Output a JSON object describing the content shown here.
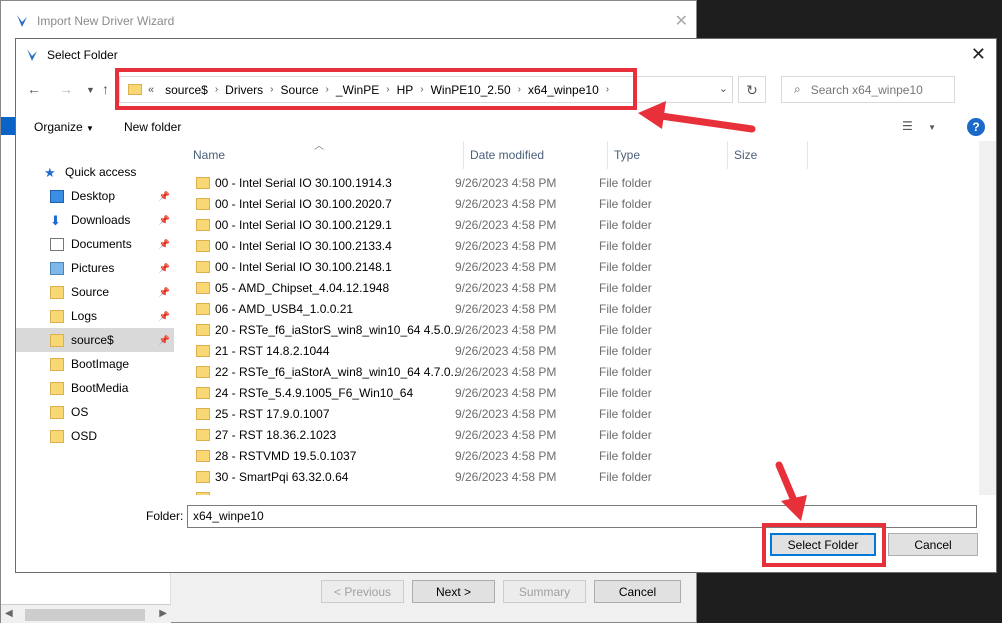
{
  "wizard": {
    "title": "Import New Driver Wizard",
    "buttons": {
      "previous": "< Previous",
      "next": "Next >",
      "summary": "Summary",
      "cancel": "Cancel"
    }
  },
  "dialog": {
    "title": "Select Folder",
    "breadcrumb": [
      "«",
      "source$",
      "Drivers",
      "Source",
      "_WinPE",
      "HP",
      "WinPE10_2.50",
      "x64_winpe10"
    ],
    "search_placeholder": "Search x64_winpe10",
    "toolbar": {
      "organize": "Organize",
      "new_folder": "New folder"
    },
    "columns": {
      "name": "Name",
      "date": "Date modified",
      "type": "Type",
      "size": "Size"
    },
    "sidebar": [
      {
        "label": "Quick access",
        "icon": "star-icon",
        "pinned": false
      },
      {
        "label": "Desktop",
        "icon": "desktop-icon",
        "pinned": true
      },
      {
        "label": "Downloads",
        "icon": "download-arrow-icon",
        "pinned": true
      },
      {
        "label": "Documents",
        "icon": "documents-icon",
        "pinned": true
      },
      {
        "label": "Pictures",
        "icon": "pictures-icon",
        "pinned": true
      },
      {
        "label": "Source",
        "icon": "folder-icon",
        "pinned": true
      },
      {
        "label": "Logs",
        "icon": "folder-icon",
        "pinned": true
      },
      {
        "label": "source$",
        "icon": "network-folder-icon",
        "pinned": true,
        "selected": true
      },
      {
        "label": "BootImage",
        "icon": "folder-icon",
        "pinned": false
      },
      {
        "label": "BootMedia",
        "icon": "folder-icon",
        "pinned": false
      },
      {
        "label": "OS",
        "icon": "folder-icon",
        "pinned": false
      },
      {
        "label": "OSD",
        "icon": "folder-icon",
        "pinned": false
      }
    ],
    "files": [
      {
        "name": "00 - Intel Serial IO 30.100.1914.3",
        "date": "9/26/2023 4:58 PM",
        "type": "File folder"
      },
      {
        "name": "00 - Intel Serial IO 30.100.2020.7",
        "date": "9/26/2023 4:58 PM",
        "type": "File folder"
      },
      {
        "name": "00 - Intel Serial IO 30.100.2129.1",
        "date": "9/26/2023 4:58 PM",
        "type": "File folder"
      },
      {
        "name": "00 - Intel Serial IO 30.100.2133.4",
        "date": "9/26/2023 4:58 PM",
        "type": "File folder"
      },
      {
        "name": "00 - Intel Serial IO 30.100.2148.1",
        "date": "9/26/2023 4:58 PM",
        "type": "File folder"
      },
      {
        "name": "05 - AMD_Chipset_4.04.12.1948",
        "date": "9/26/2023 4:58 PM",
        "type": "File folder"
      },
      {
        "name": "06 - AMD_USB4_1.0.0.21",
        "date": "9/26/2023 4:58 PM",
        "type": "File folder"
      },
      {
        "name": "20 - RSTe_f6_iaStorS_win8_win10_64 4.5.0....",
        "date": "9/26/2023 4:58 PM",
        "type": "File folder"
      },
      {
        "name": "21 - RST 14.8.2.1044",
        "date": "9/26/2023 4:58 PM",
        "type": "File folder"
      },
      {
        "name": "22 - RSTe_f6_iaStorA_win8_win10_64 4.7.0....",
        "date": "9/26/2023 4:58 PM",
        "type": "File folder"
      },
      {
        "name": "24 - RSTe_5.4.9.1005_F6_Win10_64",
        "date": "9/26/2023 4:58 PM",
        "type": "File folder"
      },
      {
        "name": "25 - RST 17.9.0.1007",
        "date": "9/26/2023 4:58 PM",
        "type": "File folder"
      },
      {
        "name": "27 - RST 18.36.2.1023",
        "date": "9/26/2023 4:58 PM",
        "type": "File folder"
      },
      {
        "name": "28 - RSTVMD 19.5.0.1037",
        "date": "9/26/2023 4:58 PM",
        "type": "File folder"
      },
      {
        "name": "30 - SmartPqi 63.32.0.64",
        "date": "9/26/2023 4:58 PM",
        "type": "File folder"
      }
    ],
    "folder_label": "Folder:",
    "folder_value": "x64_winpe10",
    "select_button": "Select Folder",
    "cancel_button": "Cancel"
  },
  "colors": {
    "annotation": "#e8303a",
    "accent": "#0078d7",
    "folder": "#f8d775"
  }
}
